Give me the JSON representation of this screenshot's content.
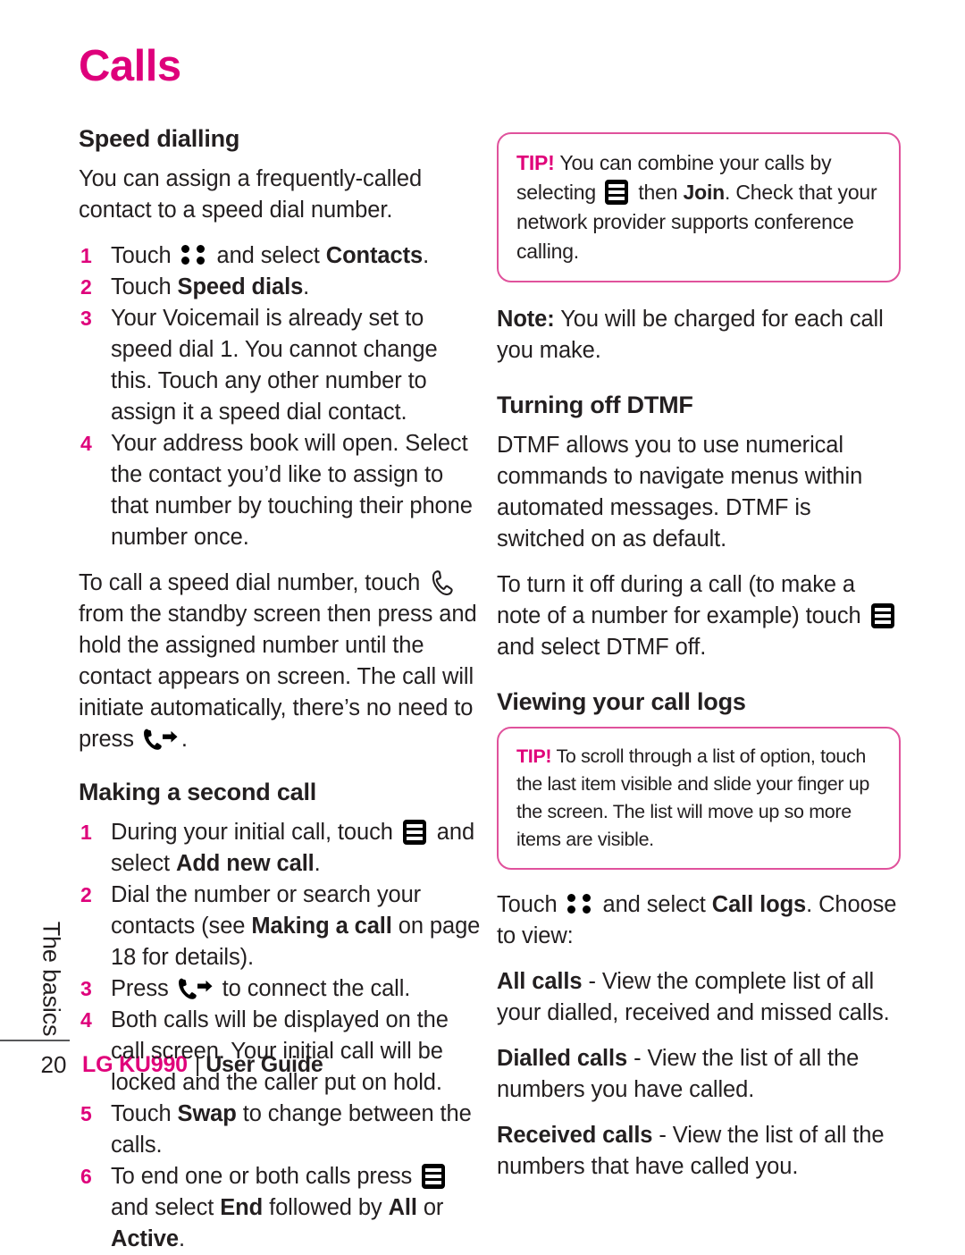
{
  "chapter": {
    "title": "Calls"
  },
  "colors": {
    "accent_pink": "#DE007B",
    "tip_border": "#E0529C",
    "text": "#231F20"
  },
  "sidebar": {
    "tab_label": "The basics",
    "page_number": "20"
  },
  "footer": {
    "brand": "LG KU990",
    "separator": "|",
    "guide": "User Guide"
  },
  "left_column": {
    "speed_dialling": {
      "heading": "Speed dialling",
      "intro": "You can assign a frequently-called contact to a speed dial number.",
      "steps": [
        {
          "num": "1",
          "parts": [
            {
              "t": "text",
              "v": "Touch "
            },
            {
              "t": "icon",
              "v": "dots-grid-icon"
            },
            {
              "t": "text",
              "v": " and select "
            },
            {
              "t": "bold",
              "v": "Contacts"
            },
            {
              "t": "text",
              "v": "."
            }
          ]
        },
        {
          "num": "2",
          "parts": [
            {
              "t": "text",
              "v": "Touch "
            },
            {
              "t": "bold",
              "v": "Speed dials"
            },
            {
              "t": "text",
              "v": "."
            }
          ]
        },
        {
          "num": "3",
          "parts": [
            {
              "t": "text",
              "v": "Your Voicemail is already set to speed dial 1. You cannot change this. Touch any other number to assign it a speed dial contact."
            }
          ]
        },
        {
          "num": "4",
          "parts": [
            {
              "t": "text",
              "v": "Your address book will open. Select the contact you’d like to assign to that number by touching their phone number once."
            }
          ]
        }
      ],
      "outro_parts": [
        {
          "t": "text",
          "v": "To call a speed dial number, touch "
        },
        {
          "t": "icon",
          "v": "handset-outline-icon"
        },
        {
          "t": "text",
          "v": " from the standby screen then press and hold the assigned number until the contact appears on screen. The call will initiate automatically, there’s no need to press "
        },
        {
          "t": "icon",
          "v": "call-send-icon"
        },
        {
          "t": "text",
          "v": "."
        }
      ]
    },
    "making_second_call": {
      "heading": "Making a second call",
      "steps": [
        {
          "num": "1",
          "parts": [
            {
              "t": "text",
              "v": "During your initial call, touch "
            },
            {
              "t": "icon",
              "v": "options-key-icon"
            },
            {
              "t": "text",
              "v": " and select "
            },
            {
              "t": "bold",
              "v": "Add new call"
            },
            {
              "t": "text",
              "v": "."
            }
          ]
        },
        {
          "num": "2",
          "parts": [
            {
              "t": "text",
              "v": "Dial the number or search your contacts (see "
            },
            {
              "t": "bold",
              "v": "Making a call"
            },
            {
              "t": "text",
              "v": " on page 18 for details)."
            }
          ]
        },
        {
          "num": "3",
          "parts": [
            {
              "t": "text",
              "v": "Press "
            },
            {
              "t": "icon",
              "v": "call-send-icon"
            },
            {
              "t": "text",
              "v": " to connect the call."
            }
          ]
        },
        {
          "num": "4",
          "parts": [
            {
              "t": "text",
              "v": "Both calls will be displayed on the call screen. Your initial call will be locked and the caller put on hold."
            }
          ]
        },
        {
          "num": "5",
          "parts": [
            {
              "t": "text",
              "v": "Touch "
            },
            {
              "t": "bold",
              "v": "Swap"
            },
            {
              "t": "text",
              "v": " to change between the calls."
            }
          ]
        },
        {
          "num": "6",
          "parts": [
            {
              "t": "text",
              "v": "To end one or both calls press "
            },
            {
              "t": "icon",
              "v": "options-key-icon"
            },
            {
              "t": "text",
              "v": " and select "
            },
            {
              "t": "bold",
              "v": "End"
            },
            {
              "t": "text",
              "v": " followed by "
            },
            {
              "t": "bold",
              "v": "All"
            },
            {
              "t": "text",
              "v": " or "
            },
            {
              "t": "bold",
              "v": "Active"
            },
            {
              "t": "text",
              "v": "."
            }
          ]
        }
      ]
    }
  },
  "right_column": {
    "tip_join": {
      "label": "TIP!",
      "parts": [
        {
          "t": "text",
          "v": " You can combine your calls by selecting "
        },
        {
          "t": "icon",
          "v": "options-key-icon"
        },
        {
          "t": "text",
          "v": " then "
        },
        {
          "t": "bold",
          "v": "Join"
        },
        {
          "t": "text",
          "v": ". Check that your network provider supports conference calling."
        }
      ]
    },
    "note": {
      "label": "Note:",
      "text": " You will be charged for each call you make."
    },
    "turning_off_dtmf": {
      "heading": "Turning off DTMF",
      "paragraph": "DTMF allows you to use numerical commands to navigate menus within automated messages. DTMF is switched on as default.",
      "paragraph2_parts": [
        {
          "t": "text",
          "v": "To turn it off during a call (to make a note of a number for example) touch "
        },
        {
          "t": "icon",
          "v": "options-key-icon"
        },
        {
          "t": "text",
          "v": " and select DTMF off."
        }
      ]
    },
    "viewing_call_logs": {
      "heading": "Viewing your call logs",
      "tip_scroll": {
        "label": "TIP!",
        "text": " To scroll through a list of option, touch the last item visible and slide your finger up the screen. The list will move up so more items are visible."
      },
      "touch_line_parts": [
        {
          "t": "text",
          "v": "Touch "
        },
        {
          "t": "icon",
          "v": "dots-grid-icon"
        },
        {
          "t": "text",
          "v": " and select "
        },
        {
          "t": "bold",
          "v": "Call logs"
        },
        {
          "t": "text",
          "v": ". Choose to view:"
        }
      ],
      "entries": [
        {
          "term": "All calls",
          "desc": " - View the complete list of all your dialled, received and missed calls."
        },
        {
          "term": "Dialled calls",
          "desc": " - View the list of all the numbers you have called."
        },
        {
          "term": "Received calls",
          "desc": " - View the list of all the numbers that have called you."
        }
      ]
    }
  }
}
